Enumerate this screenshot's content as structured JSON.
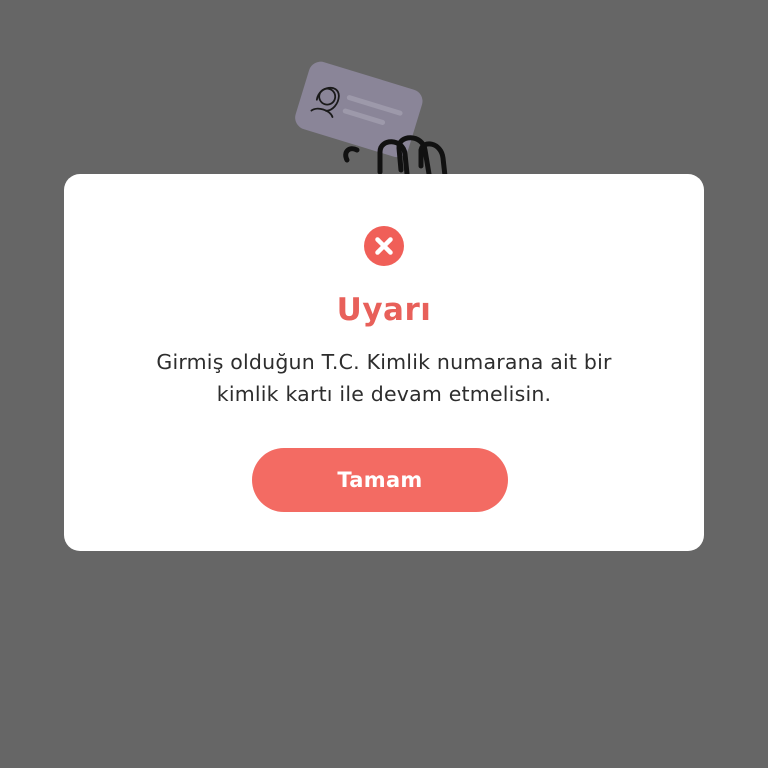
{
  "colors": {
    "backdrop": "#666666",
    "dialog_background": "#ffffff",
    "accent": "#f36b63",
    "title": "#e8605a",
    "message_text": "#2d2d2d"
  },
  "dialog": {
    "icon": "close-circle-icon",
    "title": "Uyarı",
    "message_line1": "Girmiş olduğun T.C. Kimlik numarana ait bir",
    "message_line2": "kimlik kartı ile devam etmelisin.",
    "ok_label": "Tamam"
  },
  "background": {
    "illustration_icon": "hand-holding-id-card-icon"
  }
}
